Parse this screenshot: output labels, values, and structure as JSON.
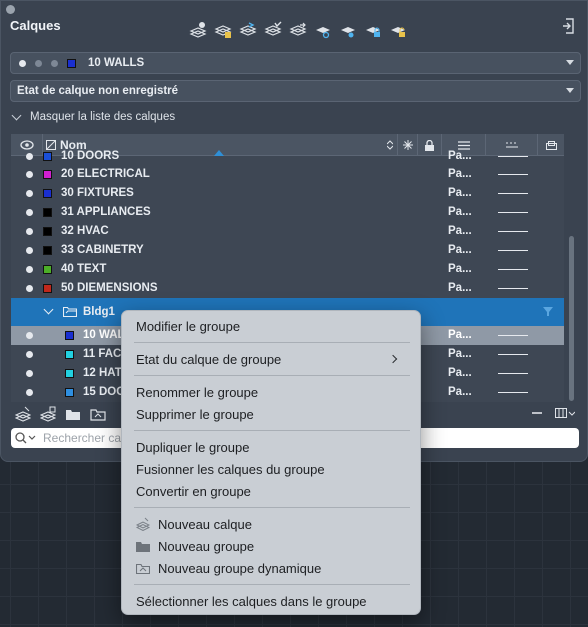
{
  "panel": {
    "title": "Calques",
    "toolbar_icons": [
      "new-layer-icon",
      "new-layer-vp-icon",
      "layer-states-icon",
      "layer-match-icon",
      "layer-previous-icon",
      "layer-isolate-icon",
      "layer-unisolate-icon",
      "layer-lock-icon",
      "layer-unlock-icon"
    ]
  },
  "current_layer": {
    "name": "10 WALLS",
    "color": "#1a2fd0"
  },
  "layer_state": "Etat de calque non enregistré",
  "mask_list_label": "Masquer la liste des calques",
  "table": {
    "header": {
      "name": "Nom"
    },
    "rows": [
      {
        "name": "10 DOORS",
        "color": "#1a4fd8",
        "plot": "Pa..."
      },
      {
        "name": "20 ELECTRICAL",
        "color": "#d11fd1",
        "plot": "Pa..."
      },
      {
        "name": "30 FIXTURES",
        "color": "#1a2fd0",
        "plot": "Pa..."
      },
      {
        "name": "31 APPLIANCES",
        "color": "#000000",
        "plot": "Pa..."
      },
      {
        "name": "32 HVAC",
        "color": "#000000",
        "plot": "Pa..."
      },
      {
        "name": "33 CABINETRY",
        "color": "#000000",
        "plot": "Pa..."
      },
      {
        "name": "40 TEXT",
        "color": "#4caf28",
        "plot": "Pa..."
      },
      {
        "name": "50 DIEMENSIONS",
        "color": "#c0281c",
        "plot": "Pa..."
      }
    ],
    "group": {
      "name": "Bldg1"
    },
    "children": [
      {
        "name": "10 WALL",
        "color": "#1a2fd0",
        "plot": "Pa..."
      },
      {
        "name": "11 FACI",
        "color": "#22d0e0",
        "plot": "Pa..."
      },
      {
        "name": "12 HATC",
        "color": "#22d0e0",
        "plot": "Pa..."
      },
      {
        "name": "15 DOO",
        "color": "#2f8fe0",
        "plot": "Pa..."
      }
    ]
  },
  "search": {
    "placeholder": "Rechercher ca"
  },
  "context_menu": {
    "items": [
      {
        "label": "Modifier le groupe"
      },
      {
        "label": "Etat du calque de groupe"
      },
      {
        "label": "Renommer le groupe"
      },
      {
        "label": "Supprimer le groupe"
      },
      {
        "label": "Dupliquer le groupe"
      },
      {
        "label": "Fusionner les calques du groupe"
      },
      {
        "label": "Convertir en groupe"
      },
      {
        "label": "Nouveau calque"
      },
      {
        "label": "Nouveau groupe"
      },
      {
        "label": "Nouveau groupe dynamique"
      },
      {
        "label": "Sélectionner les calques dans le groupe"
      }
    ]
  }
}
